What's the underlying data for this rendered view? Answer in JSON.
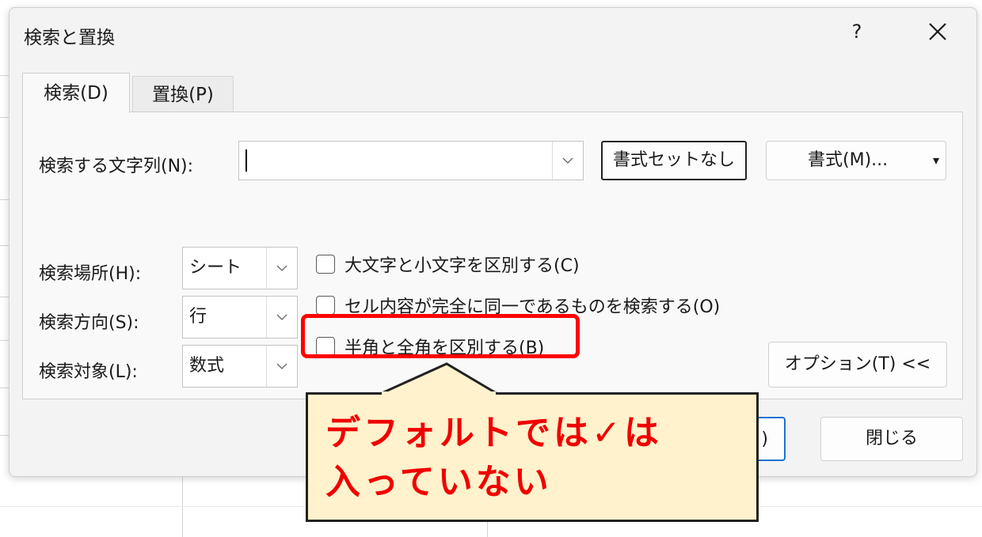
{
  "dialog": {
    "title": "検索と置換",
    "help": "?",
    "close_icon": "close-icon"
  },
  "tabs": [
    {
      "label": "検索(D)",
      "active": true
    },
    {
      "label": "置換(P)",
      "active": false
    }
  ],
  "search": {
    "label": "検索する文字列(N):",
    "value": "",
    "no_format_label": "書式セットなし",
    "format_label": "書式(M)...",
    "format_dropdown": "▾"
  },
  "options": {
    "within": {
      "label": "検索場所(H):",
      "value": "シート"
    },
    "direction": {
      "label": "検索方向(S):",
      "value": "行"
    },
    "look_in": {
      "label": "検索対象(L):",
      "value": "数式"
    },
    "checkboxes": [
      {
        "label": "大文字と小文字を区別する(C)",
        "checked": false
      },
      {
        "label": "セル内容が完全に同一であるものを検索する(O)",
        "checked": false
      },
      {
        "label": "半角と全角を区別する(B)",
        "checked": false
      }
    ],
    "toggle_label": "オプション(T) <<"
  },
  "footer": {
    "primary_partial": ")",
    "close_label": "閉じる"
  },
  "annotation": {
    "line1": "デフォルトでは✓は",
    "line2": "入っていない",
    "border_color": "#ff0000",
    "text_color": "#f00000",
    "bg_color": "#fff2cc"
  }
}
